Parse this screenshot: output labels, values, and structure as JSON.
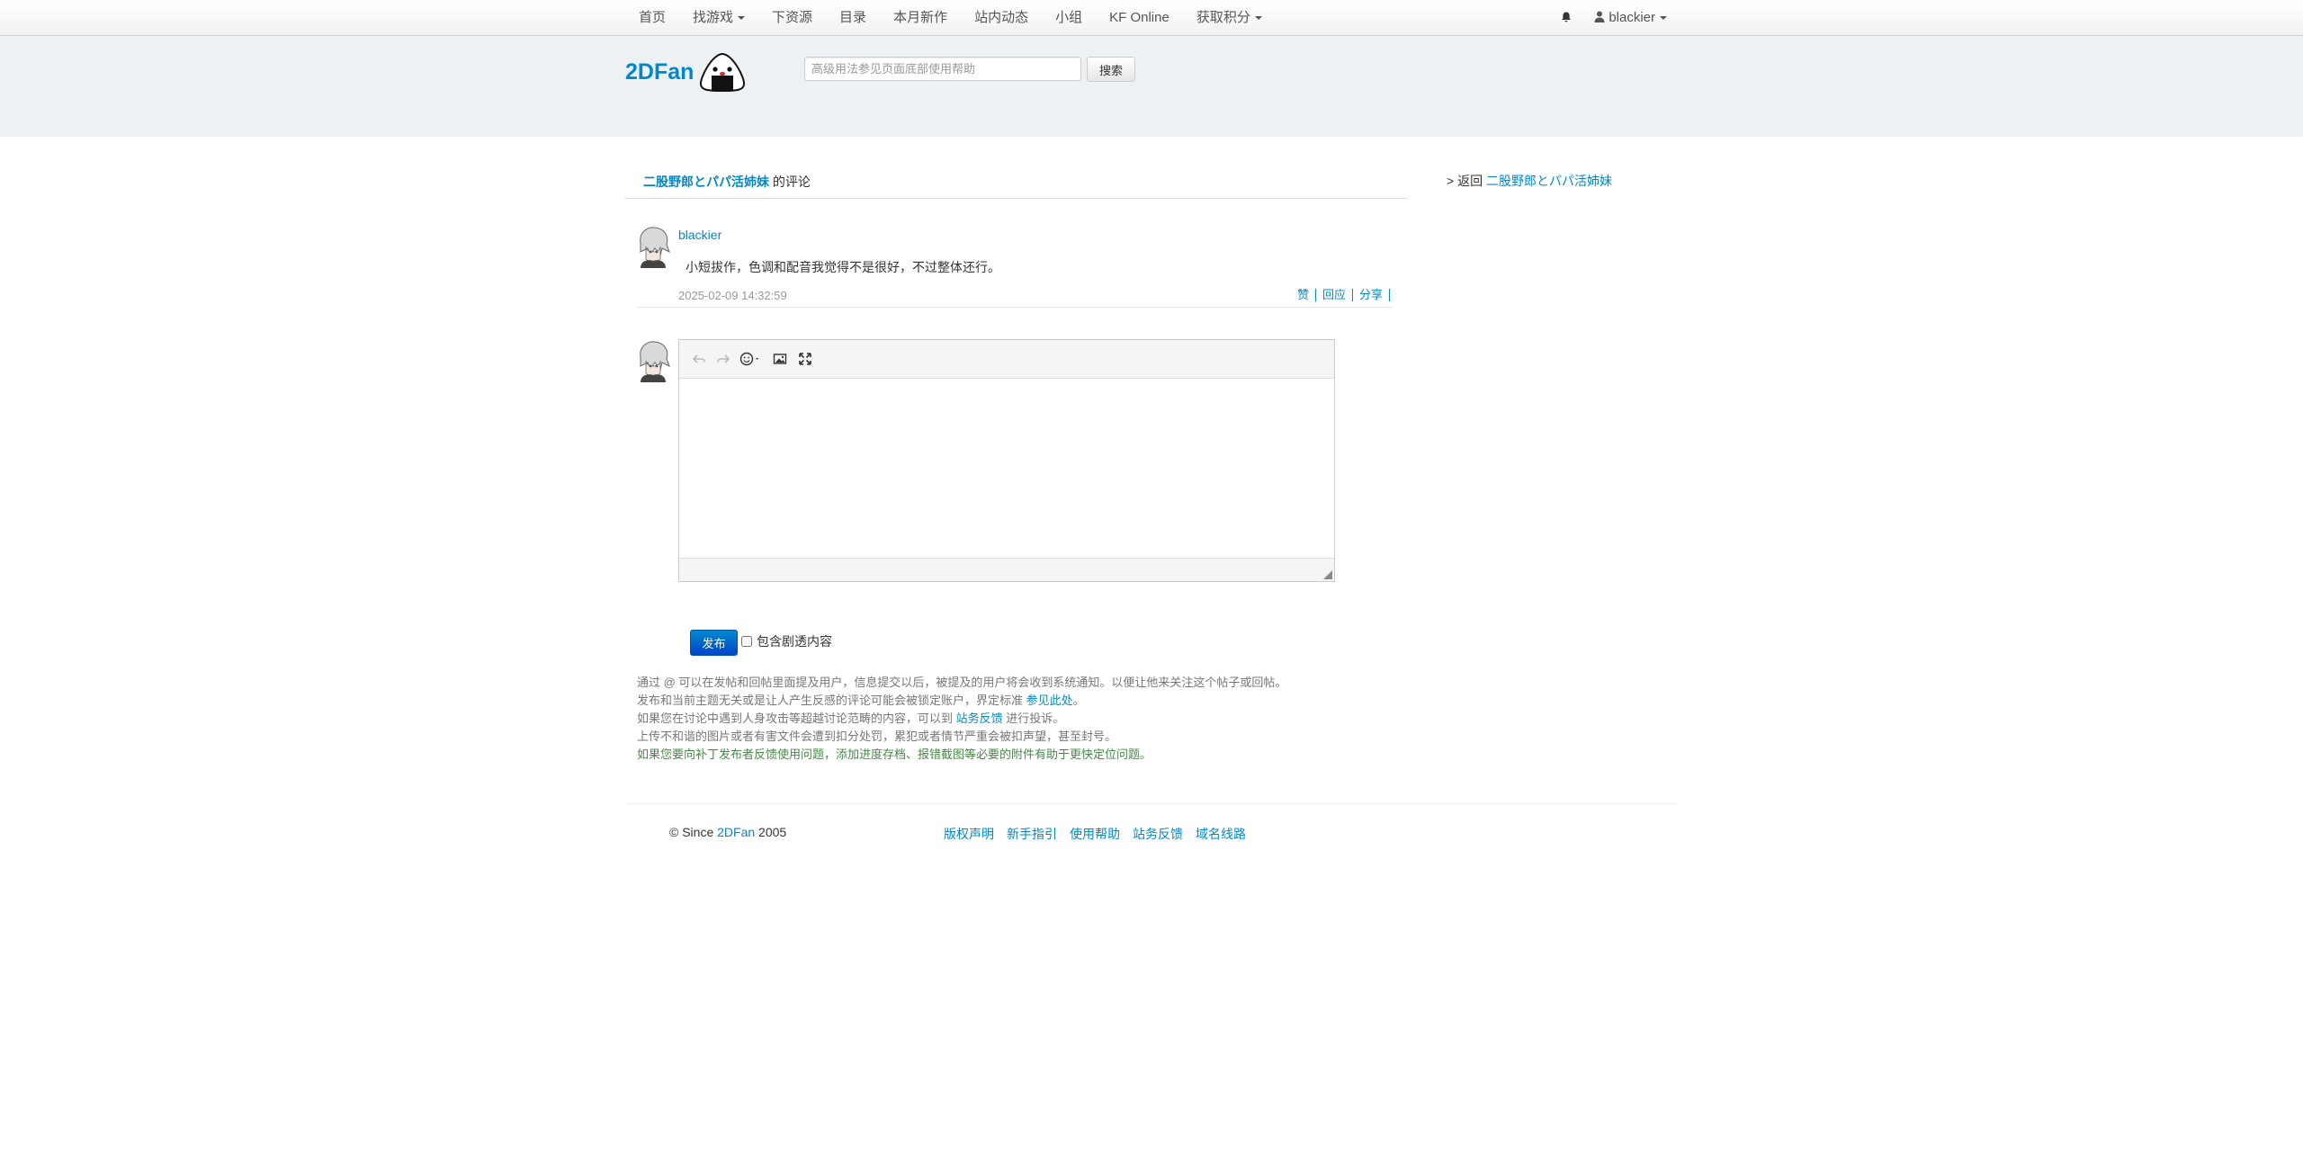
{
  "navbar": {
    "items": [
      {
        "label": "首页",
        "dropdown": false
      },
      {
        "label": "找游戏",
        "dropdown": true
      },
      {
        "label": "下资源",
        "dropdown": false
      },
      {
        "label": "目录",
        "dropdown": false
      },
      {
        "label": "本月新作",
        "dropdown": false
      },
      {
        "label": "站内动态",
        "dropdown": false
      },
      {
        "label": "小组",
        "dropdown": false
      },
      {
        "label": "KF Online",
        "dropdown": false
      },
      {
        "label": "获取积分",
        "dropdown": true
      }
    ],
    "username": "blackier"
  },
  "header": {
    "logo": "2DFan",
    "search_placeholder": "高级用法参见页面底部使用帮助",
    "search_button": "搜索"
  },
  "main": {
    "game_title": "二股野郎とパパ活姉妹",
    "title_suffix": "的评论",
    "back_prefix": "> 返回",
    "back_title": "二股野郎とパパ活姉妹",
    "comment": {
      "author": "blackier",
      "text": "小短拔作，色调和配音我觉得不是很好，不过整体还行。",
      "time": "2025-02-09 14:32:59",
      "actions": [
        "赞",
        "回应",
        "分享"
      ]
    },
    "publish_button": "发布",
    "spoiler_label": "包含剧透内容",
    "notes": {
      "line1": "通过 @ 可以在发帖和回帖里面提及用户，信息提交以后，被提及的用户将会收到系统通知。以便让他来关注这个帖子或回帖。",
      "line2_prefix": "发布和当前主题无关或是让人产生反感的评论可能会被锁定账户，界定标准",
      "line2_link": "参见此处",
      "line2_suffix": "。",
      "line3_prefix": "如果您在讨论中遇到人身攻击等超越讨论范畴的内容，可以到",
      "line3_link": "站务反馈",
      "line3_suffix": "进行投诉。",
      "line4": "上传不和谐的图片或者有害文件会遭到扣分处罚，累犯或者情节严重会被扣声望，甚至封号。",
      "line5": "如果您要向补丁发布者反馈使用问题，添加进度存档、报错截图等必要的附件有助于更快定位问题。"
    }
  },
  "footer": {
    "copyright_prefix": "© Since",
    "copyright_link": "2DFan",
    "copyright_year": "2005",
    "links": [
      "版权声明",
      "新手指引",
      "使用帮助",
      "站务反馈",
      "域名线路"
    ]
  },
  "colors": {
    "link": "#0088cc",
    "header_bg": "#eef1f4",
    "note_text": "#777777",
    "note_green": "#468847",
    "primary_button": "#0074cc"
  }
}
